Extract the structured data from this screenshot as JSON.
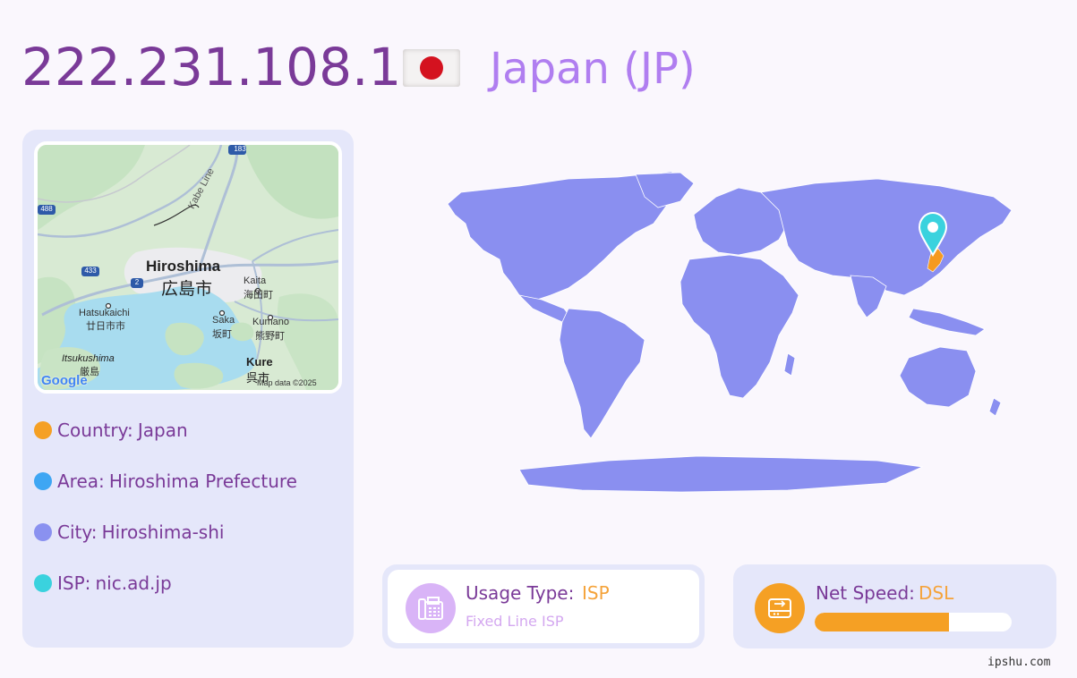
{
  "header": {
    "ip": "222.231.108.1",
    "country_title": "Japan (JP)"
  },
  "minimap": {
    "labels": {
      "hiroshima": "Hiroshima",
      "hiroshima_jp": "広島市",
      "kaita": "Kaita",
      "kaita_jp": "海田町",
      "hatsukaichi": "Hatsukaichi",
      "hatsukaichi_jp": "廿日市市",
      "saka": "Saka",
      "saka_jp": "坂町",
      "kumano": "Kumano",
      "kumano_jp": "熊野町",
      "itsukushima": "Itsukushima",
      "itsukushima_jp": "厳島",
      "kure": "Kure",
      "kure_jp": "呉市",
      "kabe_line": "Kabe Line",
      "google": "Google",
      "attribution": "Map data ©2025",
      "route_183": "183",
      "route_488": "488",
      "route_433": "433",
      "route_2": "2"
    }
  },
  "info": {
    "country_label": "Country:",
    "country_value": "Japan",
    "area_label": "Area:",
    "area_value": "Hiroshima Prefecture",
    "city_label": "City:",
    "city_value": "Hiroshima-shi",
    "isp_label": "ISP:",
    "isp_value": "nic.ad.jp",
    "dot_colors": {
      "country": "#f5a024",
      "area": "#3ea6f3",
      "city": "#8a91f0",
      "isp": "#3ad2de"
    }
  },
  "usage": {
    "label": "Usage Type:",
    "value": "ISP",
    "sub": "Fixed Line ISP",
    "icon": "fax-phone-icon"
  },
  "speed": {
    "label": "Net Speed:",
    "value": "DSL",
    "progress": 0.68,
    "icon": "hard-drive-transfer-icon"
  },
  "world_map": {
    "land_color": "#8a8ff0",
    "highlight_color": "#f59a1f",
    "pin_color": "#3ad2de"
  },
  "footer": {
    "site": "ipshu.com"
  }
}
